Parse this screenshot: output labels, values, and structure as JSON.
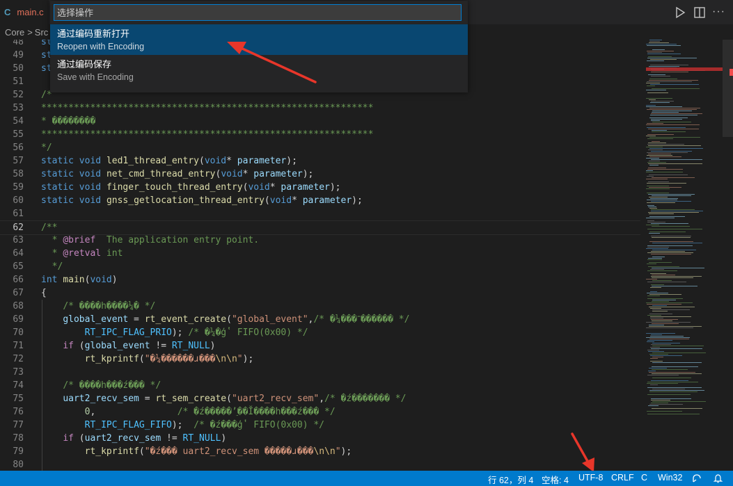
{
  "tab": {
    "icon": "C",
    "filename": "main.c"
  },
  "breadcrumb": [
    "Core",
    ">",
    "Src"
  ],
  "quick_pick": {
    "placeholder": "选择操作",
    "items": [
      {
        "label": "通过编码重新打开",
        "description": "Reopen with Encoding"
      },
      {
        "label": "通过编码保存",
        "description": "Save with Encoding"
      }
    ]
  },
  "editor": {
    "current_line": "62",
    "lines": [
      {
        "n": "48",
        "code": "st"
      },
      {
        "n": "49",
        "code": "st"
      },
      {
        "n": "50",
        "code": "st"
      },
      {
        "n": "51",
        "code": ""
      },
      {
        "n": "52",
        "code": "/*"
      },
      {
        "n": "53",
        "code": "*************************************************************"
      },
      {
        "n": "54",
        "code": "* ��������"
      },
      {
        "n": "55",
        "code": "*************************************************************"
      },
      {
        "n": "56",
        "code": "*/"
      },
      {
        "n": "57",
        "code": "static void led1_thread_entry(void* parameter);"
      },
      {
        "n": "58",
        "code": "static void net_cmd_thread_entry(void* parameter);"
      },
      {
        "n": "59",
        "code": "static void finger_touch_thread_entry(void* parameter);"
      },
      {
        "n": "60",
        "code": "static void gnss_getlocation_thread_entry(void* parameter);"
      },
      {
        "n": "61",
        "code": ""
      },
      {
        "n": "62",
        "code": "/**"
      },
      {
        "n": "63",
        "code": "  * @brief  The application entry point."
      },
      {
        "n": "64",
        "code": "  * @retval int"
      },
      {
        "n": "65",
        "code": "  */"
      },
      {
        "n": "66",
        "code": "int main(void)"
      },
      {
        "n": "67",
        "code": "{"
      },
      {
        "n": "68",
        "code": "    /* ����һ����¼� */"
      },
      {
        "n": "69",
        "code": "    global_event = rt_event_create(\"global_event\",/* �¼���־������ */"
      },
      {
        "n": "70",
        "code": "        RT_IPC_FLAG_PRIO); /* �¼�ģʽ FIFO(0x00) */"
      },
      {
        "n": "71",
        "code": "    if (global_event != RT_NULL)"
      },
      {
        "n": "72",
        "code": "        rt_kprintf(\"�¼������ɹ���\\n\\n\");"
      },
      {
        "n": "73",
        "code": ""
      },
      {
        "n": "74",
        "code": "    /* ����һ���ź��� */"
      },
      {
        "n": "75",
        "code": "    uart2_recv_sem = rt_sem_create(\"uart2_recv_sem\",/* �ź������� */"
      },
      {
        "n": "76",
        "code": "        0,               /* �ź�����ʼֵ��Ĭ����һ���ź��� */"
      },
      {
        "n": "77",
        "code": "        RT_IPC_FLAG_FIFO);  /* �ź���ģʽ FIFO(0x00) */"
      },
      {
        "n": "78",
        "code": "    if (uart2_recv_sem != RT_NULL)"
      },
      {
        "n": "79",
        "code": "        rt_kprintf(\"�ź��� uart2_recv_sem �����ɹ���\\n\\n\");"
      },
      {
        "n": "80",
        "code": ""
      }
    ]
  },
  "status_bar": {
    "position": "行 62，列 4",
    "spaces": "空格: 4",
    "encoding": "UTF-8",
    "eol": "CRLF",
    "language": "C",
    "platform": "Win32"
  },
  "colors": {
    "accent": "#007acc",
    "selection": "#094771",
    "arrow": "#e8362a"
  }
}
